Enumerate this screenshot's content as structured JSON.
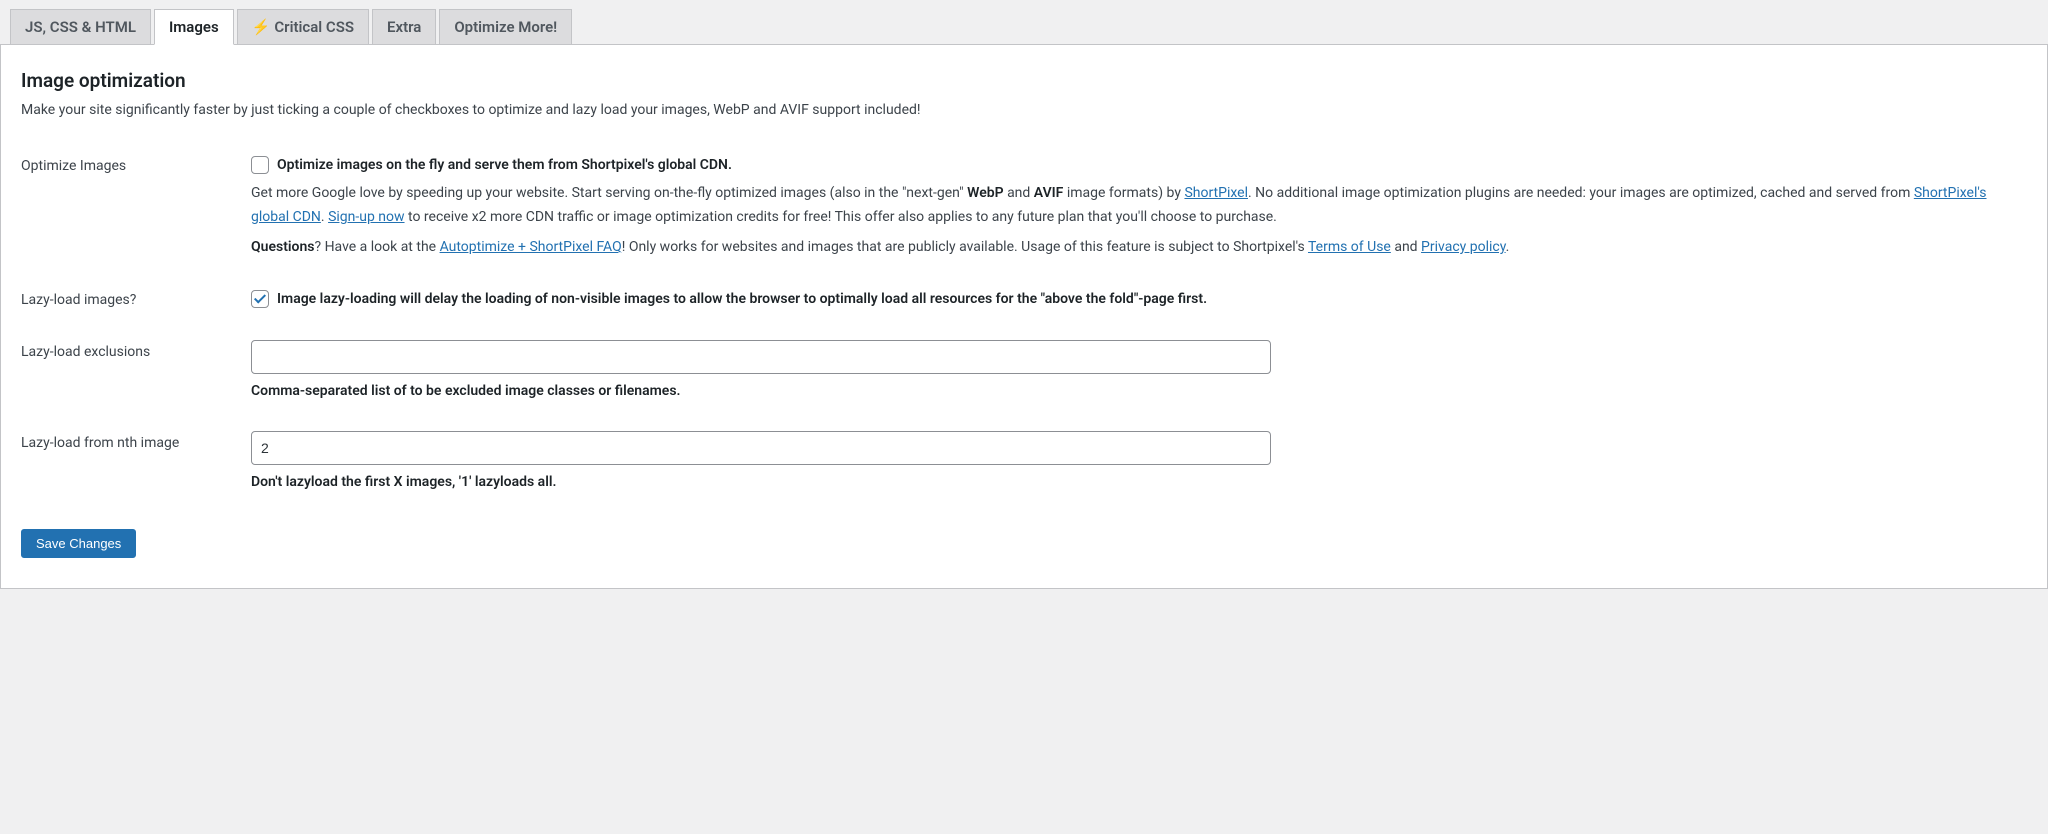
{
  "tabs": [
    {
      "label": "JS, CSS & HTML",
      "active": false,
      "hasBolt": false
    },
    {
      "label": "Images",
      "active": true,
      "hasBolt": false
    },
    {
      "label": "Critical CSS",
      "active": false,
      "hasBolt": true
    },
    {
      "label": "Extra",
      "active": false,
      "hasBolt": false
    },
    {
      "label": "Optimize More!",
      "active": false,
      "hasBolt": false
    }
  ],
  "section": {
    "title": "Image optimization",
    "description": "Make your site significantly faster by just ticking a couple of checkboxes to optimize and lazy load your images, WebP and AVIF support included!"
  },
  "optimize": {
    "label": "Optimize Images",
    "checked": false,
    "checkbox_label": "Optimize images on the fly and serve them from Shortpixel's global CDN.",
    "p1_a": "Get more Google love by speeding up your website. Start serving on-the-fly optimized images (also in the \"next-gen\" ",
    "p1_webp": "WebP",
    "p1_and": " and ",
    "p1_avif": "AVIF",
    "p1_b": " image formats) by ",
    "link_shortpixel": "ShortPixel",
    "p1_c": ". No additional image optimization plugins are needed: your images are optimized, cached and served from ",
    "link_cdn": "ShortPixel's global CDN",
    "p1_d": ". ",
    "link_signup": "Sign-up now",
    "p1_e": " to receive x2 more CDN traffic or image optimization credits for free! This offer also applies to any future plan that you'll choose to purchase.",
    "p2_a": "Questions",
    "p2_b": "? Have a look at the ",
    "link_faq": "Autoptimize + ShortPixel FAQ",
    "p2_c": "! Only works for websites and images that are publicly available. Usage of this feature is subject to Shortpixel's ",
    "link_terms": "Terms of Use",
    "p2_d": " and ",
    "link_privacy": "Privacy policy",
    "p2_e": "."
  },
  "lazyload": {
    "label": "Lazy-load images?",
    "checked": true,
    "checkbox_label": "Image lazy-loading will delay the loading of non-visible images to allow the browser to optimally load all resources for the \"above the fold\"-page first."
  },
  "exclusions": {
    "label": "Lazy-load exclusions",
    "value": "",
    "help": "Comma-separated list of to be excluded image classes or filenames."
  },
  "nth": {
    "label": "Lazy-load from nth image",
    "value": "2",
    "help": "Don't lazyload the first X images, '1' lazyloads all."
  },
  "save_button": "Save Changes"
}
